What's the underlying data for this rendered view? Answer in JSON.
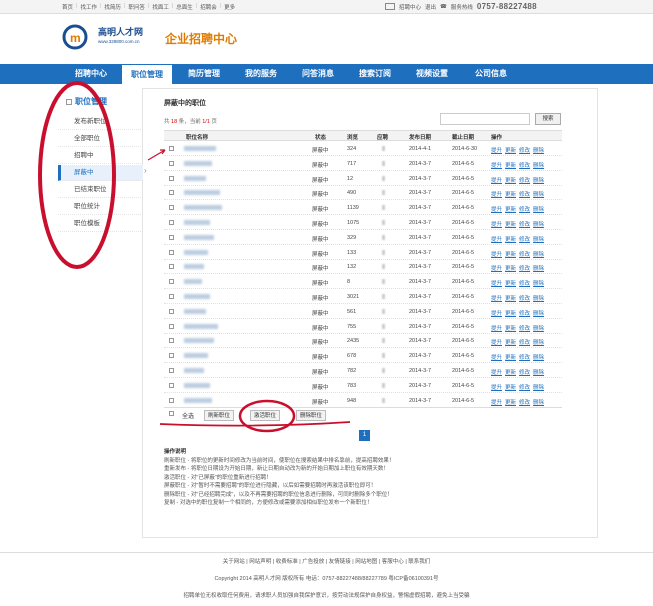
{
  "topnav": [
    "首页",
    "找工作",
    "找简历",
    "职问答",
    "找面工",
    "总面生",
    "招聘会",
    "更多"
  ],
  "topright": {
    "items": [
      "招聘中心",
      "退出",
      "服务热线"
    ],
    "hotline": "0757-88227488"
  },
  "logo": {
    "name": "高明人才网",
    "url": "www.328800.com.cn",
    "title": "企业招聘中心"
  },
  "mainnav": [
    "招聘中心",
    "职位管理",
    "简历管理",
    "我的服务",
    "问答消息",
    "搜索订阅",
    "视频设置",
    "公司信息"
  ],
  "sidebar": {
    "title": "职位管理",
    "items": [
      "发布新职位",
      "全部职位",
      "招聘中",
      "屏蔽中",
      "已结束职位",
      "职位统计",
      "职位模板"
    ]
  },
  "main": {
    "title": "屏蔽中的职位",
    "count": {
      "prefix": "共",
      "total": "18",
      "mid": "条，当前",
      "page": "1/1",
      "suffix": "页"
    },
    "search_button": "搜索",
    "columns": [
      "职位名称",
      "状态",
      "浏览",
      "应聘",
      "发布日期",
      "截止日期",
      "操作"
    ],
    "ops": [
      "提升",
      "更新",
      "修改",
      "删除"
    ],
    "rows": [
      {
        "status": "屏蔽中",
        "views": "324",
        "pub": "2014-4-1",
        "end": "2014-6-30"
      },
      {
        "status": "屏蔽中",
        "views": "717",
        "pub": "2014-3-7",
        "end": "2014-6-5"
      },
      {
        "status": "屏蔽中",
        "views": "12",
        "pub": "2014-3-7",
        "end": "2014-6-5"
      },
      {
        "status": "屏蔽中",
        "views": "490",
        "pub": "2014-3-7",
        "end": "2014-6-5"
      },
      {
        "status": "屏蔽中",
        "views": "1139",
        "pub": "2014-3-7",
        "end": "2014-6-5"
      },
      {
        "status": "屏蔽中",
        "views": "1075",
        "pub": "2014-3-7",
        "end": "2014-6-5"
      },
      {
        "status": "屏蔽中",
        "views": "329",
        "pub": "2014-3-7",
        "end": "2014-6-5"
      },
      {
        "status": "屏蔽中",
        "views": "133",
        "pub": "2014-3-7",
        "end": "2014-6-5"
      },
      {
        "status": "屏蔽中",
        "views": "132",
        "pub": "2014-3-7",
        "end": "2014-6-5"
      },
      {
        "status": "屏蔽中",
        "views": "8",
        "pub": "2014-3-7",
        "end": "2014-6-5"
      },
      {
        "status": "屏蔽中",
        "views": "3021",
        "pub": "2014-3-7",
        "end": "2014-6-5"
      },
      {
        "status": "屏蔽中",
        "views": "561",
        "pub": "2014-3-7",
        "end": "2014-6-5"
      },
      {
        "status": "屏蔽中",
        "views": "755",
        "pub": "2014-3-7",
        "end": "2014-6-5"
      },
      {
        "status": "屏蔽中",
        "views": "2435",
        "pub": "2014-3-7",
        "end": "2014-6-5"
      },
      {
        "status": "屏蔽中",
        "views": "678",
        "pub": "2014-3-7",
        "end": "2014-6-5"
      },
      {
        "status": "屏蔽中",
        "views": "782",
        "pub": "2014-3-7",
        "end": "2014-6-5"
      },
      {
        "status": "屏蔽中",
        "views": "783",
        "pub": "2014-3-7",
        "end": "2014-6-5"
      },
      {
        "status": "屏蔽中",
        "views": "948",
        "pub": "2014-3-7",
        "end": "2014-6-5"
      }
    ],
    "bottom": {
      "select_all": "全选",
      "refresh": "刷新职位",
      "restore": "激活职位",
      "delete": "删除职位"
    },
    "pager": "1"
  },
  "notes": {
    "title": "操作说明",
    "lines": [
      "刷新职位 - 将职位的更新时间修改为当前时间，使职位在搜索结果中排名靠前，提高招聘效果！",
      "重新发布 - 将职位日期设为开始日期，新让日期自动改为新的开始日期加上职位有效期天数！",
      "激活职位 - 对\"已屏蔽\"的职位重新进行招聘！",
      "屏蔽职位 - 对\"暂时不需要招聘\"的职位进行隐藏，以后如需要招聘时再激活该职位即可！",
      "删除职位 - 对\"已经招聘完成\"，以及不再需要招聘的职位信息进行删除，可同时删除多个职位！",
      "复制 - 对选中的职位复制一个相同的，方便修改或需要添加相似职位发布一个新职位！"
    ]
  },
  "footer": {
    "links": [
      "关于网站",
      "网站声明",
      "收费标准",
      "广告投放",
      "友情链接",
      "网站地图",
      "客服中心",
      "联系我们"
    ],
    "copy": "Copyright 2014 高明人才网 版权所有 电话：0757-88227488/88227789 粤ICP备06100391号",
    "warn": "招聘单位无权收取任何费用，请求职人员加强自我保护意识，按劳动法规保护自身权益，警惕虚假招聘，避免上当受骗"
  },
  "colors": {
    "brand_blue": "#1f6fbf",
    "accent_orange": "#e07b00",
    "annotation_red": "#c8102e"
  }
}
